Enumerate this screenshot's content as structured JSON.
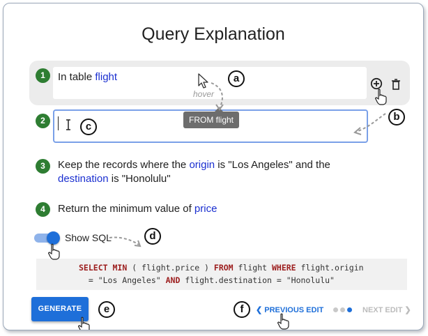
{
  "header": {
    "title": "Query Explanation"
  },
  "steps": [
    {
      "number": "1",
      "prefix": "In table ",
      "keyword": "flight"
    },
    {
      "number": "2",
      "text": ""
    },
    {
      "number": "3",
      "line1_a": "Keep the records where the ",
      "line1_kw": "origin",
      "line1_b": " is \"Los Angeles\" and the",
      "line2_kw": "destination",
      "line2_b": " is \"Honolulu\""
    },
    {
      "number": "4",
      "prefix": "Return the minimum value of ",
      "keyword": "price"
    }
  ],
  "tooltip": {
    "text": "FROM flight"
  },
  "hover_note": "hover",
  "icons": {
    "add": "plus-circle-icon",
    "delete": "trash-icon",
    "cursor": "arrow-cursor-icon",
    "text_cursor": "i-beam-icon",
    "hand": "hand-pointer-icon"
  },
  "callouts": {
    "a": "a",
    "b": "b",
    "c": "c",
    "d": "d",
    "e": "e",
    "f": "f"
  },
  "sql_toggle": {
    "label": "Show SQL",
    "on": true
  },
  "sql": {
    "line1": {
      "k1": "SELECT",
      "k2": "MIN",
      "t1": " ( flight.price ) ",
      "k3": "FROM",
      "t2": " flight ",
      "k4": "WHERE",
      "t3": " flight.origin"
    },
    "line2": {
      "t1": "  = \"Los Angeles\" ",
      "k1": "AND",
      "t2": " flight.destination = \"Honolulu\""
    }
  },
  "actions": {
    "generate": "GENERATE",
    "previous": "PREVIOUS EDIT",
    "next": "NEXT EDIT"
  },
  "colors": {
    "accent": "#1e6fd9",
    "step_badge": "#2e7d32",
    "keyword": "#1a2fd0",
    "sql_keyword": "#9c1d1d"
  }
}
